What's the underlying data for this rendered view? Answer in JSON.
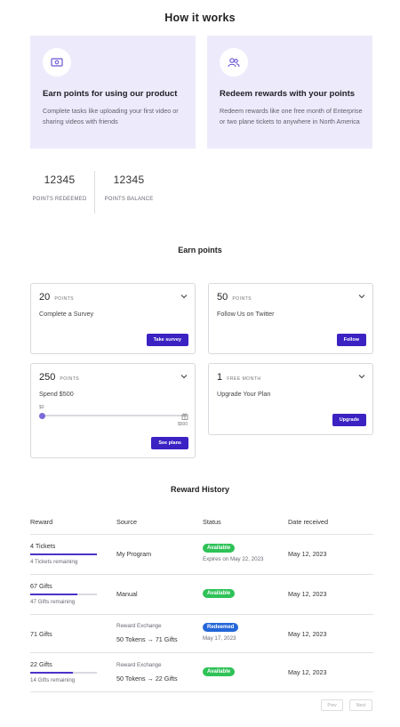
{
  "how_it_works": {
    "title": "How it works",
    "cards": [
      {
        "icon": "money-icon",
        "heading": "Earn points for using our product",
        "text": "Complete tasks like uploading your first video or sharing videos with friends"
      },
      {
        "icon": "users-icon",
        "heading": "Redeem rewards with your points",
        "text": "Redeem rewards like one free month of Enterprise or two plane tickets to anywhere in North America"
      }
    ]
  },
  "stats": [
    {
      "value": "12345",
      "label": "POINTS REDEEMED"
    },
    {
      "value": "12345",
      "label": "POINTS BALANCE"
    }
  ],
  "earn_points": {
    "title": "Earn points",
    "cards": [
      {
        "value": "20",
        "unit": "POINTS",
        "description": "Complete a Survey",
        "action": "Take survey"
      },
      {
        "value": "50",
        "unit": "POINTS",
        "description": "Follow Us on Twitter",
        "action": "Follow"
      },
      {
        "value": "250",
        "unit": "POINTS",
        "description": "Spend $500",
        "action": "See plans",
        "slider": {
          "min": "$0",
          "max": "$500",
          "progress": 0
        }
      },
      {
        "value": "1",
        "unit": "FREE MONTH",
        "description": "Upgrade Your Plan",
        "action": "Upgrade"
      }
    ]
  },
  "reward_history": {
    "title": "Reward History",
    "columns": [
      "Reward",
      "Source",
      "Status",
      "Date received"
    ],
    "rows": [
      {
        "reward": "4 Tickets",
        "remaining": "4 Tickets remaining",
        "progress": 1.0,
        "source": "My Program",
        "status": "Available",
        "status_color": "#2ec257",
        "status_note": "Expires on May 22, 2023",
        "date": "May 12, 2023"
      },
      {
        "reward": "67 Gifts",
        "remaining": "47 Gifts remaining",
        "progress": 0.7,
        "source": "Manual",
        "status": "Available",
        "status_color": "#2ec257",
        "date": "May 12, 2023"
      },
      {
        "reward": "71 Gifts",
        "source_label": "Reward Exchange",
        "source": "50 Tokens → 71 Gifts",
        "status": "Redeemed",
        "status_color": "#2366d8",
        "status_note": "May 17, 2023",
        "date": "May 12, 2023"
      },
      {
        "reward": "22 Gifts",
        "remaining": "14 Gifts remaining",
        "progress": 0.64,
        "source_label": "Reward Exchange",
        "source": "50 Tokens → 22 Gifts",
        "status": "Available",
        "status_color": "#2ec257",
        "date": "May 12, 2023"
      }
    ],
    "pagination": {
      "prev": "Prev",
      "next": "Next"
    }
  },
  "accent_color": "#3a22c3",
  "card_background": "#edebfb"
}
